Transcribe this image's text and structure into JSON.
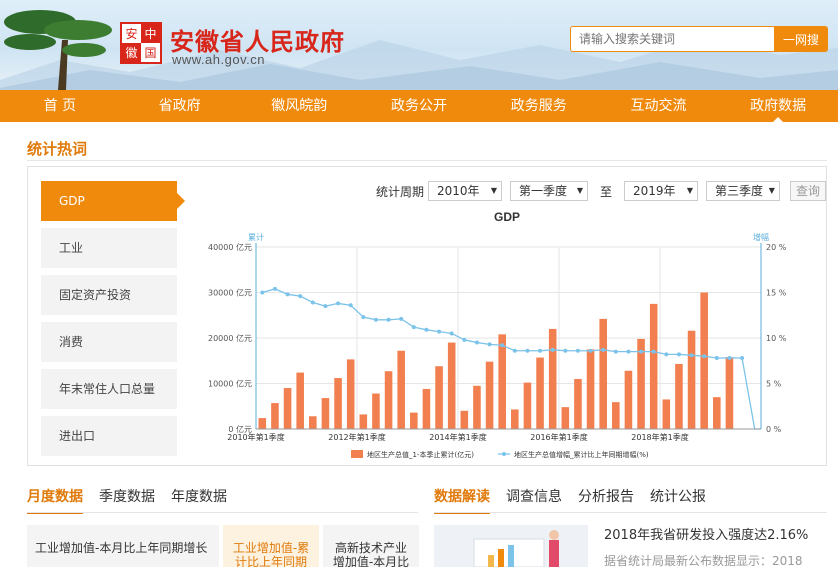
{
  "header": {
    "seal_chars": [
      "安",
      "中",
      "徽",
      "国"
    ],
    "site_title": "安徽省人民政府",
    "site_url": "www.ah.gov.cn",
    "search_placeholder": "请输入搜索关键词",
    "search_button": "一网搜"
  },
  "nav": {
    "items": [
      "首 页",
      "省政府",
      "徽风皖韵",
      "政务公开",
      "政务服务",
      "互动交流",
      "政府数据"
    ],
    "active": 6
  },
  "section": {
    "title": "统计热词"
  },
  "sidebar": {
    "items": [
      "GDP",
      "工业",
      "固定资产投资",
      "消费",
      "年末常住人口总量",
      "进出口"
    ],
    "active": 0
  },
  "filters": {
    "period_label": "统计周期",
    "from_year": "2010年",
    "from_quarter": "第一季度",
    "to_label": "至",
    "to_year": "2019年",
    "to_quarter": "第三季度",
    "query_button": "查询"
  },
  "chart_data": {
    "type": "bar",
    "title": "GDP",
    "left_axis_title": "累计",
    "right_axis_title": "增幅",
    "ylim": [
      0,
      40000
    ],
    "y2lim": [
      0,
      20
    ],
    "y_ticks": [
      "0 亿元",
      "10000 亿元",
      "20000 亿元",
      "30000 亿元",
      "40000 亿元"
    ],
    "y2_ticks": [
      "0 %",
      "5 %",
      "10 %",
      "15 %",
      "20 %"
    ],
    "x_tick_labels": [
      "2010年第1季度",
      "2012年第1季度",
      "2014年第1季度",
      "2016年第1季度",
      "2018年第1季度"
    ],
    "categories": [
      "2010Q1",
      "2010Q2",
      "2010Q3",
      "2010Q4",
      "2011Q1",
      "2011Q2",
      "2011Q3",
      "2011Q4",
      "2012Q1",
      "2012Q2",
      "2012Q3",
      "2012Q4",
      "2013Q1",
      "2013Q2",
      "2013Q3",
      "2013Q4",
      "2014Q1",
      "2014Q2",
      "2014Q3",
      "2014Q4",
      "2015Q1",
      "2015Q2",
      "2015Q3",
      "2015Q4",
      "2016Q1",
      "2016Q2",
      "2016Q3",
      "2016Q4",
      "2017Q1",
      "2017Q2",
      "2017Q3",
      "2017Q4",
      "2018Q1",
      "2018Q2",
      "2018Q3",
      "2018Q4",
      "2019Q1",
      "2019Q2",
      "2019Q3",
      "2019Q4"
    ],
    "series": [
      {
        "name": "地区生产总值_1-本季止累计(亿元)",
        "type": "bar",
        "color": "#f27f4f",
        "values": [
          2400,
          5700,
          9000,
          12400,
          2800,
          6800,
          11200,
          15300,
          3200,
          7800,
          12700,
          17200,
          3600,
          8800,
          13800,
          19000,
          4000,
          9500,
          14800,
          20800,
          4300,
          10200,
          15700,
          22000,
          4800,
          11000,
          17500,
          24200,
          5900,
          12800,
          19800,
          27500,
          6500,
          14300,
          21600,
          30000,
          7000,
          15800,
          0,
          0
        ]
      },
      {
        "name": "地区生产总值增幅_累计比上年同期增幅(%)",
        "type": "line",
        "color": "#7cc3ea",
        "values": [
          15.0,
          15.4,
          14.8,
          14.6,
          13.9,
          13.5,
          13.8,
          13.6,
          12.3,
          12.0,
          12.0,
          12.1,
          11.2,
          10.9,
          10.7,
          10.5,
          9.8,
          9.5,
          9.3,
          9.2,
          8.6,
          8.6,
          8.6,
          8.7,
          8.6,
          8.6,
          8.6,
          8.7,
          8.5,
          8.5,
          8.5,
          8.5,
          8.2,
          8.2,
          8.1,
          8.0,
          7.8,
          7.8,
          7.8,
          0
        ]
      }
    ],
    "legend_position": "bottom-center",
    "grid": true
  },
  "bottom_left": {
    "tabs": [
      "月度数据",
      "季度数据",
      "年度数据"
    ],
    "active": 0,
    "cards": [
      "工业增加值-本月比上年同期增长",
      "工业增加值-累计比上年同期",
      "高新技术产业增加值-本月比"
    ]
  },
  "bottom_right": {
    "tabs": [
      "数据解读",
      "调查信息",
      "分析报告",
      "统计公报"
    ],
    "active": 0,
    "news_title": "2018年我省研发投入强度达2.16%",
    "news_summary": "据省统计局最新公布数据显示：2018"
  }
}
